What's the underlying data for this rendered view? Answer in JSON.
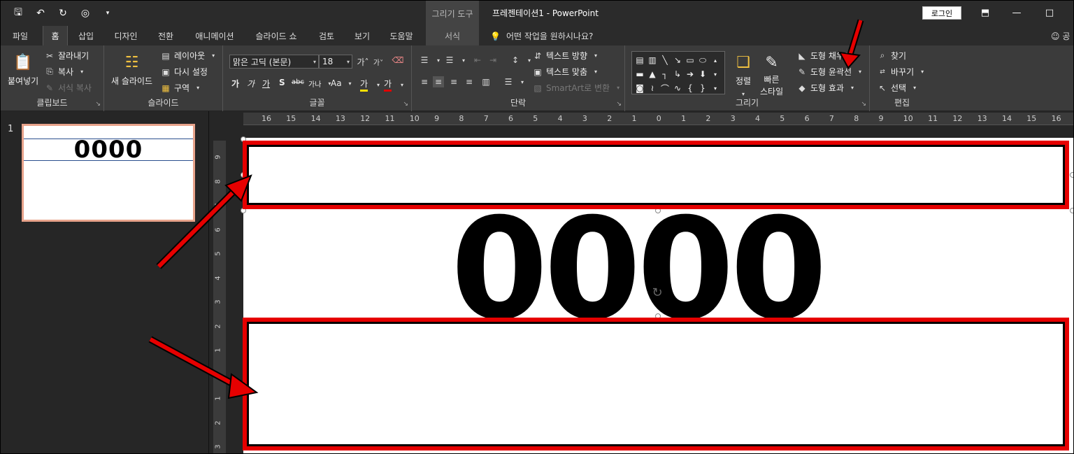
{
  "window": {
    "context_tools": "그리기 도구",
    "title": "프레젠테이션1  -  PowerPoint",
    "login": "로그인"
  },
  "tabs": [
    {
      "label": "파일"
    },
    {
      "label": "홈"
    },
    {
      "label": "삽입"
    },
    {
      "label": "디자인"
    },
    {
      "label": "전환"
    },
    {
      "label": "애니메이션"
    },
    {
      "label": "슬라이드 쇼"
    },
    {
      "label": "검토"
    },
    {
      "label": "보기"
    },
    {
      "label": "도움말"
    },
    {
      "label": "서식"
    }
  ],
  "tell_me": "어떤 작업을 원하시나요?",
  "user": "공",
  "ribbon": {
    "clipboard": {
      "label": "클립보드",
      "paste": "붙여넣기",
      "cut": "잘라내기",
      "copy": "복사",
      "format_painter": "서식 복사"
    },
    "slides": {
      "label": "슬라이드",
      "new_slide": "새 슬라이드",
      "layout": "레이아웃",
      "reset": "다시 설정",
      "section": "구역"
    },
    "font": {
      "label": "글꼴",
      "font_name": "맑은 고딕 (본문)",
      "font_size": "18",
      "bold": "가",
      "italic": "가",
      "underline": "가",
      "shadow": "S",
      "strike": "abc",
      "spacing": "가나",
      "case": "Aa",
      "highlight": "가",
      "color": "가"
    },
    "paragraph": {
      "label": "단락",
      "text_direction": "텍스트 방향",
      "align_text": "텍스트 맞춤",
      "smartart": "SmartArt로 변환"
    },
    "drawing": {
      "label": "그리기",
      "arrange": "정렬",
      "quick_styles_1": "빠른",
      "quick_styles_2": "스타일",
      "shape_fill": "도형 채우기",
      "shape_outline": "도형 윤곽선",
      "shape_effects": "도형 효과"
    },
    "editing": {
      "label": "편집",
      "find": "찾기",
      "replace": "바꾸기",
      "select": "선택"
    }
  },
  "thumbnails": [
    {
      "number": "1",
      "text": "0000"
    }
  ],
  "slide": {
    "text": "0000"
  },
  "hruler_ticks": [
    "16",
    "15",
    "14",
    "13",
    "12",
    "11",
    "10",
    "9",
    "8",
    "7",
    "6",
    "5",
    "4",
    "3",
    "2",
    "1",
    "0",
    "1",
    "2",
    "3",
    "4",
    "5",
    "6",
    "7",
    "8",
    "9",
    "10",
    "11",
    "12",
    "13",
    "14",
    "15",
    "16"
  ],
  "vruler_ticks": [
    "9",
    "8",
    "7",
    "6",
    "5",
    "4",
    "3",
    "2",
    "1",
    "0",
    "1",
    "2",
    "3"
  ],
  "colors": {
    "annotation": "#e60000",
    "thumb_border": "#e8a38b",
    "ribbon_bg": "#3b3b3b"
  }
}
